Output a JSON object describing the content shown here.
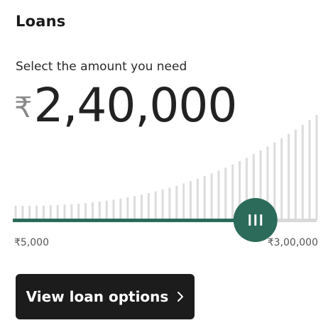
{
  "header": {
    "title": "Loans"
  },
  "prompt": "Select the amount you need",
  "amount": {
    "currency_symbol": "₹",
    "value": "2,40,000"
  },
  "slider": {
    "min_label": "₹5,000",
    "max_label": "₹3,00,000",
    "min": 5000,
    "max": 300000,
    "value": 240000,
    "bar_count": 44,
    "colors": {
      "track_active": "#2c6b5a",
      "track_inactive": "#d9d9d9",
      "bars": "#dcdcdc",
      "handle": "#2c6b5a",
      "handle_grip": "#ffffff"
    },
    "handle_icon": "grip-lines-icon"
  },
  "cta": {
    "label": "View loan options",
    "icon": "chevron-right-icon"
  }
}
